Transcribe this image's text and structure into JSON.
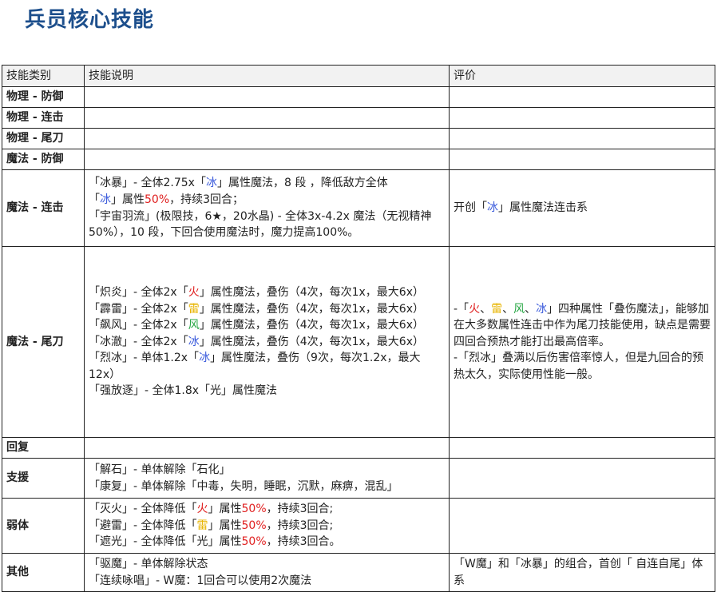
{
  "page": {
    "title": "兵员核心技能"
  },
  "table": {
    "headers": [
      "技能类别",
      "技能说明",
      "评价"
    ],
    "rows": [
      {
        "category": "物理 - 防御"
      },
      {
        "category": "物理 - 连击"
      },
      {
        "category": "物理 - 尾刀"
      },
      {
        "category": "魔法 - 防御"
      },
      {
        "category": "魔法 - 连击"
      },
      {
        "category": "魔法 - 尾刀"
      },
      {
        "category": "回复"
      },
      {
        "category": "支援"
      },
      {
        "category": "弱体"
      },
      {
        "category": "其他"
      }
    ]
  },
  "magic_combo": {
    "desc": [
      [
        "「冰暴」- 全体2.75x「",
        "冰",
        "」属性魔法，8 段 ，降低敌方全体"
      ],
      [
        "「",
        "冰",
        "」属性",
        "50%",
        "，持续3回合；"
      ],
      [
        "「宇宙羽流」(极限技，6★，20水晶) - 全体3x-4.2x 魔法（无视精神50%），10 段，下回合使用魔法时，魔力提高100%。"
      ]
    ],
    "eval": [
      "开创「",
      "冰",
      "」属性魔法连击系"
    ]
  },
  "magic_finisher": {
    "desc": [
      [
        "「炽炎」- 全体2x「",
        "火",
        "」属性魔法，叠伤（4次，每次1x，最大6x）"
      ],
      [
        "「霹雷」- 全体2x「",
        "雷",
        "」属性魔法，叠伤（4次，每次1x，最大6x）"
      ],
      [
        "「飙风」- 全体2x「",
        "风",
        "」属性魔法，叠伤（4次，每次1x，最大6x）"
      ],
      [
        "「冰澈」- 全体2x「",
        "冰",
        "」属性魔法，叠伤（4次，每次1x，最大6x）"
      ],
      [
        "「烈冰」- 单体1.2x「",
        "冰",
        "」属性魔法，叠伤（9次，每次1.2x，最大12x）"
      ],
      [
        "「强放逐」- 全体1.8x「光」属性魔法"
      ]
    ],
    "eval": [
      [
        "-「",
        "火",
        "、",
        "雷",
        "、",
        "风",
        "、",
        "冰",
        "」四种属性「叠伤魔法」，能够加在大多数属性连击中作为尾刀技能使用，缺点是需要四回合预热才能打出最高倍率。"
      ],
      [
        "-「烈冰」叠满以后伤害倍率惊人，但是九回合的预热太久，实际使用性能一般。"
      ]
    ]
  },
  "support": {
    "desc": [
      "「解石」- 单体解除「石化」",
      "「康复」- 单体解除「中毒，失明，睡眠，沉默，麻痹，混乱」"
    ]
  },
  "debuff": {
    "desc": [
      [
        "「灭火」- 全体降低「",
        "火",
        "」属性",
        "50%",
        "，持续3回合;"
      ],
      [
        "「避雷」- 全体降低「",
        "雷",
        "」属性",
        "50%",
        "，持续3回合;"
      ],
      [
        "「遮光」- 全体降低「光」属性",
        "50%",
        "，持续3回合。"
      ]
    ]
  },
  "other": {
    "desc": [
      "「驱魔」- 单体解除状态",
      "「连续咏唱」- W魔：1回合可以使用2次魔法"
    ],
    "eval": "「W魔」和「冰暴」的组合，首创「 自连自尾」体系"
  },
  "colors": {
    "title": "#1d4f8c",
    "ice": "#3b5bdc",
    "fire": "#e02020",
    "thunder": "#e8b400",
    "wind": "#28a745",
    "percent": "#e02020",
    "header_bg": "#f2f2f2",
    "border": "#222222"
  }
}
